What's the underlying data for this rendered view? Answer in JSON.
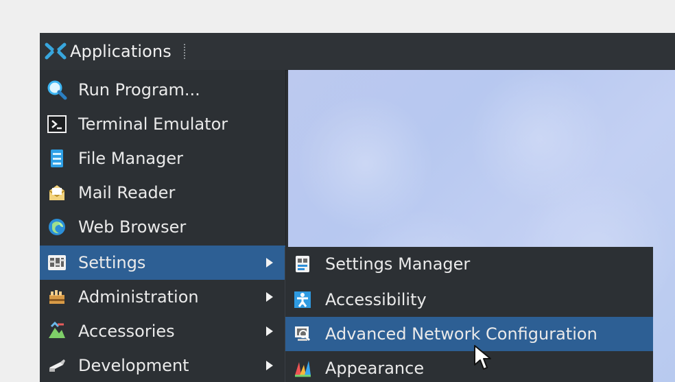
{
  "panel": {
    "menu_label": "Applications"
  },
  "menu": {
    "items": [
      {
        "label": "Run Program..."
      },
      {
        "label": "Terminal Emulator"
      },
      {
        "label": "File Manager"
      },
      {
        "label": "Mail Reader"
      },
      {
        "label": "Web Browser"
      },
      {
        "label": "Settings",
        "selected": true
      },
      {
        "label": "Administration"
      },
      {
        "label": "Accessories"
      },
      {
        "label": "Development"
      }
    ]
  },
  "submenu": {
    "items": [
      {
        "label": "Settings Manager"
      },
      {
        "label": "Accessibility"
      },
      {
        "label": "Advanced Network Configuration",
        "selected": true
      },
      {
        "label": "Appearance"
      }
    ]
  },
  "icons": {
    "applications": "xfce-logo-icon",
    "run_program": "magnifier-icon",
    "terminal": "terminal-icon",
    "file_manager": "file-manager-icon",
    "mail_reader": "mail-icon",
    "web_browser": "globe-icon",
    "settings": "settings-icon",
    "administration": "administration-icon",
    "accessories": "accessories-icon",
    "development": "development-icon",
    "settings_manager": "settings-manager-icon",
    "accessibility": "accessibility-icon",
    "network": "network-config-icon",
    "appearance": "appearance-icon",
    "cursor": "mouse-cursor-icon"
  },
  "colors": {
    "panel": "#2f3337",
    "menu": "#2c3034",
    "selection": "#2d5f94",
    "text": "#eaeaea",
    "background": "#efefef"
  }
}
